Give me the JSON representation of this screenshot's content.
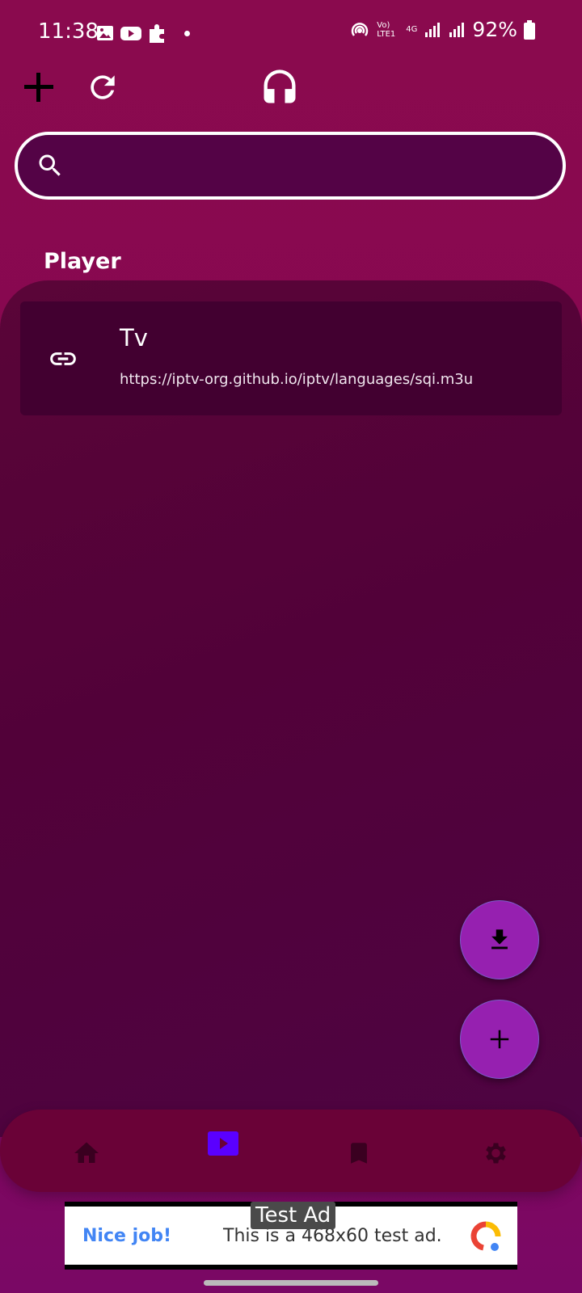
{
  "status": {
    "time": "11:38",
    "network": "Vo) LTE1",
    "net_type": "4G",
    "battery": "92%"
  },
  "toolbar": {
    "add_icon": "plus-icon",
    "refresh_icon": "refresh-icon",
    "audio_icon": "headphones-icon"
  },
  "search": {
    "value": "",
    "placeholder": ""
  },
  "section": {
    "title": "Player"
  },
  "items": [
    {
      "title": "Tv",
      "url": "https://iptv-org.github.io/iptv/languages/sqi.m3u",
      "icon": "link-icon"
    }
  ],
  "fabs": {
    "download_icon": "download-icon",
    "add_icon": "plus-icon"
  },
  "nav": {
    "items": [
      {
        "icon": "home-icon",
        "active": false
      },
      {
        "icon": "play-icon",
        "active": true
      },
      {
        "icon": "bookmark-icon",
        "active": false
      },
      {
        "icon": "settings-icon",
        "active": false
      }
    ],
    "active_color": "#5a00ff",
    "inactive_color": "#3a0020"
  },
  "ad": {
    "tag": "Test Ad",
    "headline": "Nice job!",
    "text": "This is a 468x60 test ad."
  },
  "colors": {
    "accent_fab": "#9620b0",
    "background": "#8a0a4e"
  }
}
